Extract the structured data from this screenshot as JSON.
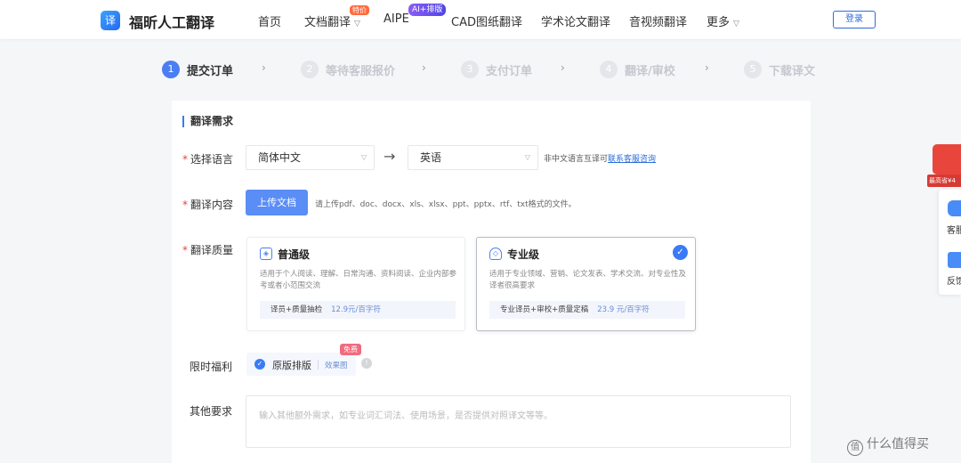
{
  "header": {
    "logo_glyph": "译",
    "brand": "福昕人工翻译",
    "nav": [
      {
        "label": "首页"
      },
      {
        "label": "文档翻译",
        "badge": "特价"
      },
      {
        "label": "AIPE",
        "badge": "AI+排版"
      },
      {
        "label": "CAD图纸翻译"
      },
      {
        "label": "学术论文翻译"
      },
      {
        "label": "音视频翻译"
      },
      {
        "label": "更多"
      }
    ],
    "login_label": "登录"
  },
  "steps": [
    {
      "num": "1",
      "label": "提交订单",
      "active": true
    },
    {
      "num": "2",
      "label": "等待客服报价",
      "active": false
    },
    {
      "num": "3",
      "label": "支付订单",
      "active": false
    },
    {
      "num": "4",
      "label": "翻译/审校",
      "active": false
    },
    {
      "num": "5",
      "label": "下载译文",
      "active": false
    }
  ],
  "form": {
    "section_title": "翻译需求",
    "required_mark": "*",
    "language": {
      "label": "选择语言",
      "source_value": "简体中文",
      "target_value": "英语",
      "note_prefix": "非中文语言互译可",
      "note_link": "联系客服咨询"
    },
    "content": {
      "label": "翻译内容",
      "upload_label": "上传文档",
      "hint": "请上传pdf、doc、docx、xls、xlsx、ppt、pptx、rtf、txt格式的文件。"
    },
    "quality": {
      "label": "翻译质量",
      "options": [
        {
          "title": "普通级",
          "desc": "适用于个人阅读、理解、日常沟通、资料阅读、企业内部参考或者小范围交流",
          "price_label": "译员+质量抽检",
          "price": "12.9元/百字符",
          "selected": false
        },
        {
          "title": "专业级",
          "desc": "适用于专业领域、营销、论文发表、学术交流、对专业性及译者很高要求",
          "price_label": "专业译员+审校+质量定稿",
          "price": "23.9 元/百字符",
          "selected": true
        }
      ]
    },
    "benefit": {
      "label": "限时福利",
      "option": "原版排版",
      "link": "效果图",
      "badge": "免费"
    },
    "other": {
      "label": "其他要求",
      "placeholder": "输入其他额外需求，如专业词汇词法、使用场景，是否提供对照译文等等。"
    }
  },
  "side": {
    "promo_text": "最高省¥4",
    "items": [
      {
        "label": "客服"
      },
      {
        "label": "反馈"
      }
    ]
  },
  "watermark": "什么值得买",
  "colors": {
    "primary": "#3a7bf5",
    "upload_button": "#5a8df5",
    "required": "#e64340",
    "free_badge": "#f06b7e",
    "ai_badge": "#6d4ee0"
  }
}
